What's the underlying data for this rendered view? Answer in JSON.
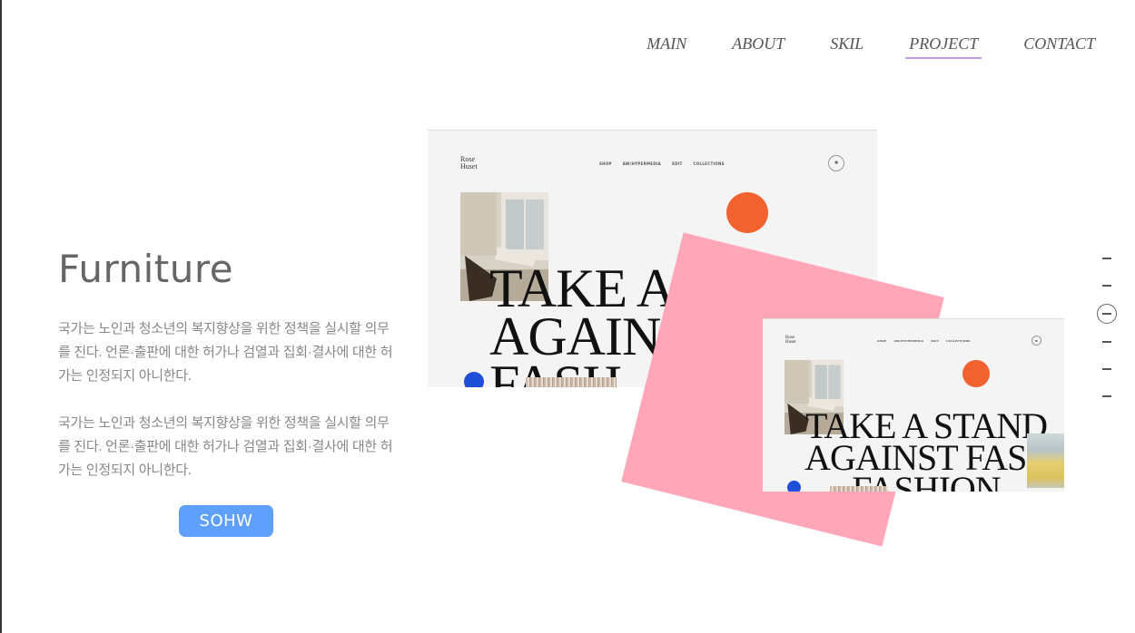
{
  "nav": {
    "items": [
      {
        "label": "MAIN"
      },
      {
        "label": "ABOUT"
      },
      {
        "label": "SKIL"
      },
      {
        "label": "PROJECT",
        "active": true
      },
      {
        "label": "CONTACT"
      }
    ]
  },
  "project": {
    "title": "Furniture",
    "description_1": "국가는 노인과 청소년의 복지향상을 위한 정책을 실시할 의무를 진다. 언론·출판에 대한 허가나 검열과 집회·결사에 대한 허가는 인정되지 아니한다.",
    "description_2": "국가는 노인과 청소년의 복지향상을 위한 정책을 실시할 의무를 진다. 언론·출판에 대한 허가나 검열과 집회·결사에 대한 허가는 인정되지 아니한다.",
    "button_label": "SOHW"
  },
  "mockup": {
    "logo": "Rose\nHuset",
    "nav": [
      "SHOP",
      "AW/HYPERMEDIA",
      "EDIT",
      "COLLECTIONS"
    ],
    "headline_big": "TAKE A S\nAGAINS\nFASH",
    "headline_small": "TAKE A STAND\nAGAINST FAST\nFASHION"
  },
  "colors": {
    "accent_underline": "#c39bf0",
    "button": "#5ea0fb",
    "pink": "#ffa7b8",
    "orange_dot": "#f2622e",
    "blue_dot": "#1f4fd8"
  },
  "pager": {
    "count": 6,
    "current": 3
  }
}
